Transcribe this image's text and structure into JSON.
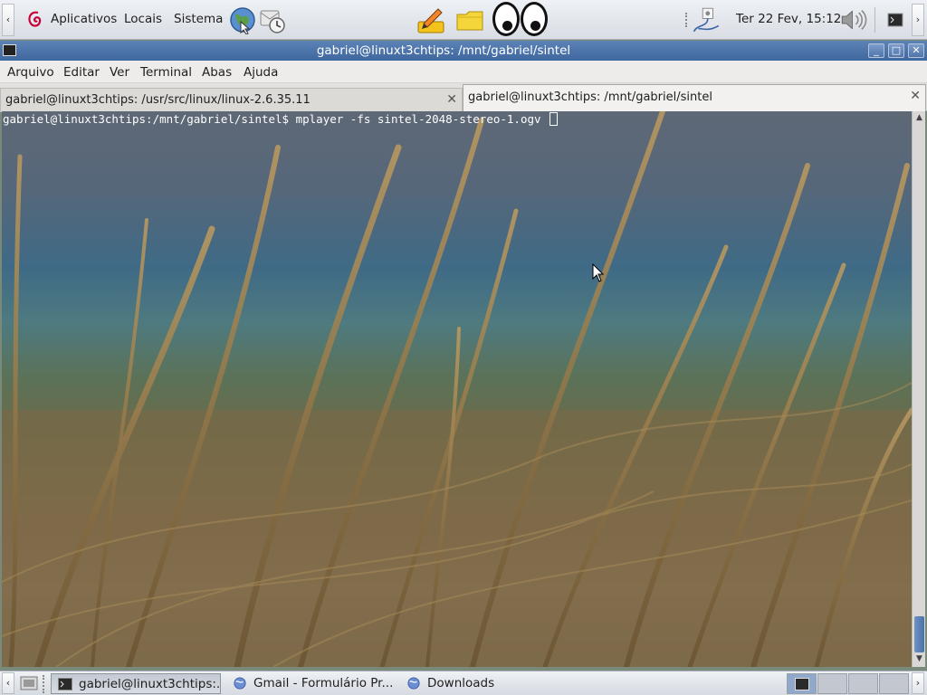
{
  "top_panel": {
    "menus": [
      "Aplicativos",
      "Locais",
      "Sistema"
    ],
    "clock": "Ter 22 Fev, 15:12"
  },
  "window": {
    "title": "gabriel@linuxt3chtips: /mnt/gabriel/sintel",
    "menu": [
      "Arquivo",
      "Editar",
      "Ver",
      "Terminal",
      "Abas",
      "Ajuda"
    ],
    "tabs": [
      {
        "label": "gabriel@linuxt3chtips: /usr/src/linux/linux-2.6.35.11",
        "active": false
      },
      {
        "label": "gabriel@linuxt3chtips: /mnt/gabriel/sintel",
        "active": true
      }
    ],
    "terminal": {
      "prompt": "gabriel@linuxt3chtips:/mnt/gabriel/sintel$",
      "command": " mplayer -fs sintel-2048-stereo-1.ogv "
    }
  },
  "taskbar": {
    "tasks": [
      {
        "label": "gabriel@linuxt3chtips:...",
        "active": true
      },
      {
        "label": "Gmail - Formulário Pr...",
        "active": false
      },
      {
        "label": "Downloads",
        "active": false
      }
    ],
    "workspace_count": 4,
    "current_workspace": 1
  },
  "colors": {
    "titlebar": "#4a70a6",
    "panel": "#e3e6eb",
    "terminal_text": "#ffffff"
  }
}
